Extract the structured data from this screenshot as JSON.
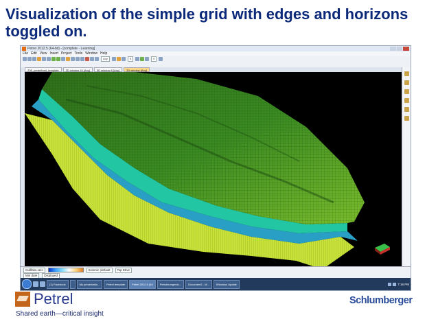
{
  "slide": {
    "title": "Visualization of the simple grid with edges and horizons toggled on."
  },
  "app": {
    "window_title": "Petrel 2012.5 (64-bit) - [complete - Learning]",
    "menu": [
      "File",
      "Edit",
      "View",
      "Insert",
      "Project",
      "Tools",
      "Window",
      "Help"
    ],
    "toolbar_dropdowns": [
      "Any",
      "9",
      "0"
    ],
    "tabs": [
      {
        "label": "Z05_predefined_template",
        "active": false
      },
      {
        "label": "3D window 16 [Any]",
        "active": false
      },
      {
        "label": "3D window 6 [Any]",
        "active": false
      },
      {
        "label": "3D window [Any]",
        "active": true
      }
    ],
    "bottom_panel": {
      "row1": {
        "field": "Gullfaks.seis",
        "seismic": "Seismic (default",
        "surface": "Top Etive"
      },
      "row2": {
        "date": "Min date",
        "display": "Displayed"
      }
    },
    "taskbar": {
      "items": [
        "(1) Facebook",
        "",
        "My presentatio...",
        "Petrel template",
        "Petrel 2012.5 (64",
        "Petroleumgeolo...",
        "Document2 - M...",
        "Windows Update"
      ],
      "active_index": 4,
      "clock": "7:16 PM"
    },
    "icons": [
      "petrel-app-icon",
      "start-orb-icon",
      "folder-icon",
      "windows-update-icon"
    ]
  },
  "footer": {
    "logo_word": "Petrel",
    "tagline": "Shared earth—critical insight",
    "company": "Schlumberger"
  },
  "colors": {
    "title": "#0d2a7a",
    "viewport_bg": "#000000",
    "horizon_top": "#2f8a1e",
    "horizon_mid": "#78b428",
    "edge_yellow": "#cfe63a",
    "edge_blue": "#2aa6c8",
    "edge_teal": "#1ec8a0"
  }
}
